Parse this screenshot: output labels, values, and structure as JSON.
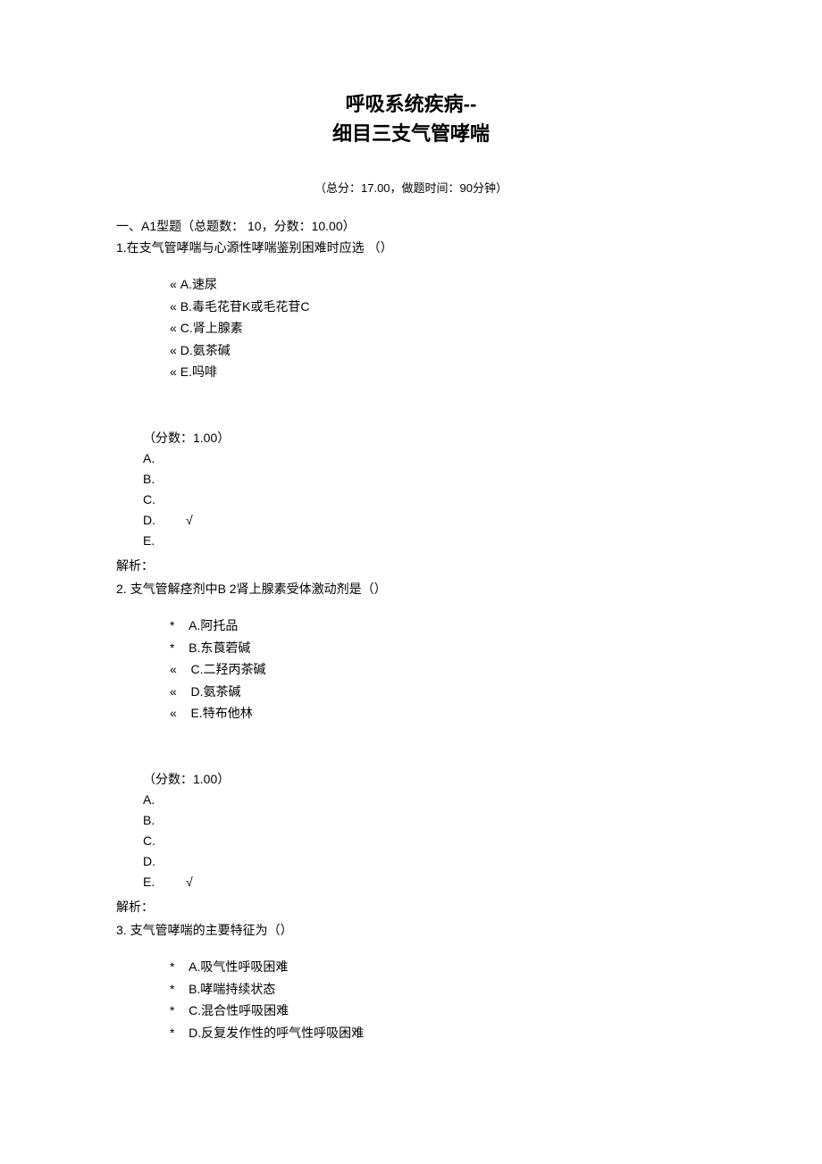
{
  "title": {
    "line1": "呼吸系统疾病--",
    "line2": "细目三支气管哮喘"
  },
  "meta": "（总分：17.00，做题时间：90分钟）",
  "section_heading": "一、A1型题（总题数：  10，分数：10.00）",
  "analysis_label": "解析：",
  "score_label": "（分数：1.00）",
  "answer_letters": [
    "A.",
    "B.",
    "C.",
    "D.",
    "E."
  ],
  "correct_mark": "√",
  "questions": [
    {
      "stem": "1.在支气管哮喘与心源性哮喘鉴别困难时应选    （）",
      "opt_marker": "«",
      "options": [
        "A.速尿",
        "B.毒毛花苷K或毛花苷C",
        "C.肾上腺素",
        "D.氨茶碱",
        "E.吗啡"
      ],
      "correct_index": 3
    },
    {
      "stem": "2.      支气管解痉剂中B 2肾上腺素受体激动剂是（）",
      "opt_marker_primary": "*",
      "opt_marker_secondary": "«",
      "options": [
        "A.阿托品",
        "B.东莨菪碱",
        "C.二羟丙茶碱",
        "D.氨茶碱",
        "E.特布他林"
      ],
      "markers": [
        "*",
        "*",
        "«",
        "«",
        "«"
      ],
      "correct_index": 4
    },
    {
      "stem": "3.      支气管哮喘的主要特征为（）",
      "opt_marker": "*",
      "options": [
        "A.吸气性呼吸困难",
        "B.哮喘持续状态",
        "C.混合性呼吸困难",
        "D.反复发作性的呼气性呼吸困难"
      ]
    }
  ]
}
